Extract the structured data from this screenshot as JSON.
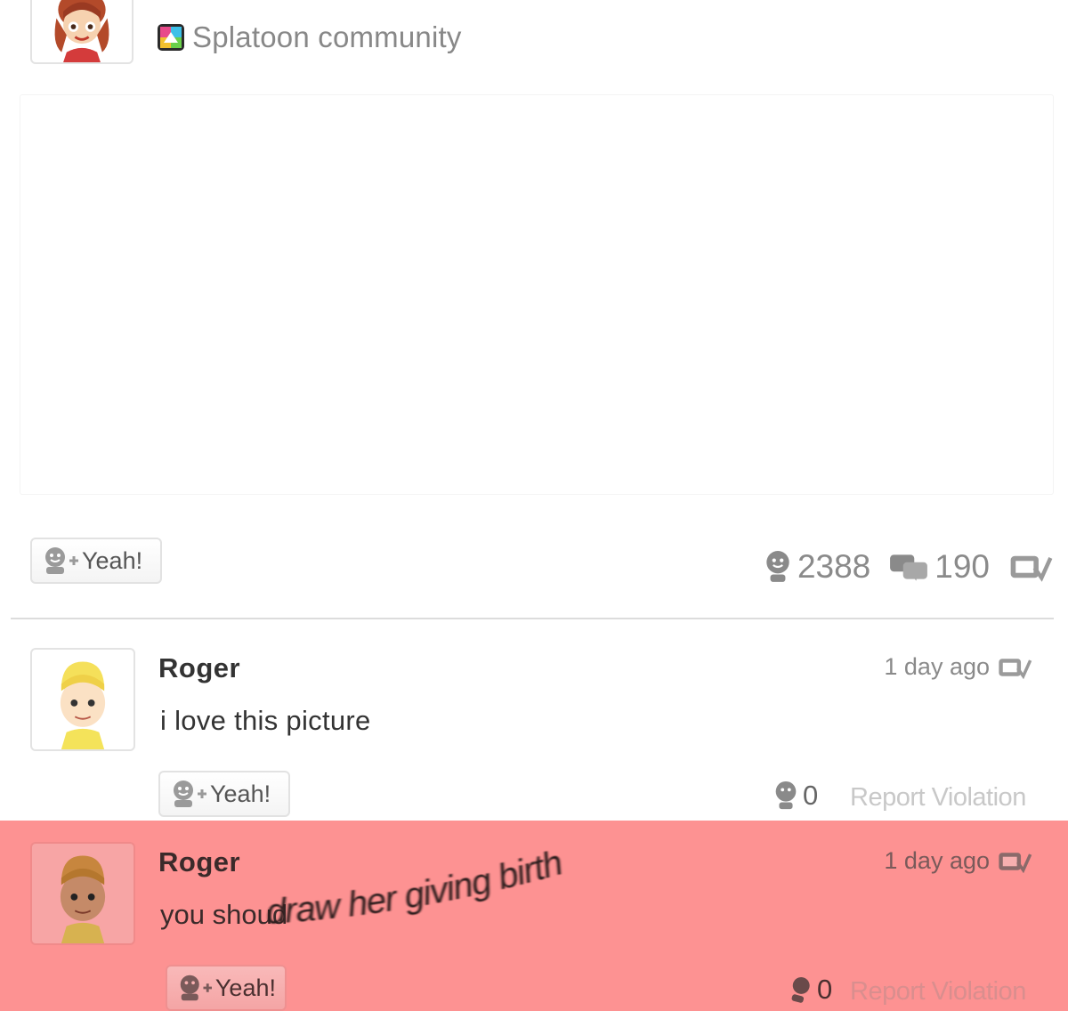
{
  "post": {
    "community_name": "Splatoon community",
    "yeah_label": "Yeah!",
    "yeah_count": "2388",
    "comment_count": "190"
  },
  "comments": [
    {
      "username": "Roger",
      "text": "i love this picture",
      "time": "1 day ago",
      "yeah_label": "Yeah!",
      "yeah_count": "0",
      "report_label": "Report Violation"
    },
    {
      "username": "Roger",
      "text_prefix": "you shoud",
      "text_warped": "draw her giving birth",
      "time": "1 day ago",
      "yeah_label": "Yeah!",
      "yeah_count": "0",
      "report_label": "Report Violation"
    }
  ],
  "colors": {
    "highlight": "#fc5a5a",
    "muted_text": "#8a8a8a",
    "body_text": "#333333",
    "border": "#e2e2e2"
  },
  "icons": [
    "community-icon",
    "yeah-icon",
    "yeah-count-icon",
    "comments-icon",
    "spoiler-icon",
    "feeling-icon"
  ]
}
